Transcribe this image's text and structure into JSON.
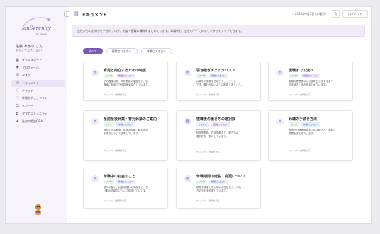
{
  "brand": {
    "logo_text": "anSerenity",
    "logo_sub": "for Parents"
  },
  "user": {
    "name": "佐藤 あかり さん",
    "greeting": "おかえりなさいませ！"
  },
  "sidebar": {
    "items": [
      {
        "label": "ダッシュボード",
        "icon": "dashboard-icon"
      },
      {
        "label": "プロフィール",
        "icon": "profile-icon"
      },
      {
        "label": "タスク",
        "icon": "task-icon"
      },
      {
        "label": "ドキュメント",
        "icon": "document-icon"
      },
      {
        "label": "チャット",
        "icon": "chat-icon"
      },
      {
        "label": "仲間のチェックイン",
        "icon": "checkin-icon"
      },
      {
        "label": "メンバー",
        "icon": "members-icon"
      },
      {
        "label": "ママのコミュニティ",
        "icon": "community-icon"
      },
      {
        "label": "社内の相談Q&A",
        "icon": "qa-icon"
      }
    ]
  },
  "header": {
    "title": "ドキュメント",
    "date": "2026年6月5日 (水曜日)",
    "logout": "ログアウト"
  },
  "notice": "会社からのお知らせや社内ブログ、制度・復職の資料をまとめています。休職中も、会社の\"今\"にゆるくキャッチアップできます。",
  "filters": [
    "すべて",
    "復職される方へ",
    "休職に入る方へ"
  ],
  "cards": [
    {
      "title": "育児と両立するための制度",
      "tags": [
        {
          "label": "リンク",
          "color": "green"
        },
        {
          "label": "復職される方へ",
          "color": "purple"
        }
      ],
      "desc": [
        "子の看護休暇、時短勤務の制度など、復",
        "職後に利用できる制度を紹介しています。"
      ],
      "link": "クリックして詳細を見る"
    },
    {
      "title": "引き継ぎチェックリスト",
      "tags": [
        {
          "label": "リンク",
          "color": "green"
        },
        {
          "label": "休職に入る方へ",
          "color": "blue"
        }
      ],
      "desc": [
        "休職前の業務引き継ぎチェックリスト",
        "です。漏れがないように確認しましょう。"
      ],
      "link": "クリックして詳細を見る"
    },
    {
      "title": "復職までの流れ",
      "tags": [
        {
          "label": "リンク",
          "color": "green"
        },
        {
          "label": "復職される方へ",
          "color": "purple"
        }
      ],
      "desc": [
        "復職の意思表示から復職日が決まるまで",
        "の手続き・流れをまとめています。"
      ],
      "link": "クリックして詳細を見る"
    },
    {
      "title": "産前産後休業・育児休業のご案内",
      "tags": [
        {
          "label": "リンク",
          "color": "green"
        },
        {
          "label": "休職に入る方へ",
          "color": "blue"
        }
      ],
      "desc": [
        "取得できる期間、申請の時期、給付金の",
        "手続きについて説明しています。"
      ],
      "link": "クリックして詳細を見る"
    },
    {
      "title": "復職後の働き方の選択肢",
      "file": "worksch.pdf",
      "tags": [
        {
          "label": "ファイル",
          "color": "blue"
        },
        {
          "label": "復職される方へ",
          "color": "purple"
        }
      ],
      "desc": [
        "短時間勤務、在宅勤務など、働き方の",
        "選択肢を一覧にしています。"
      ],
      "link": "クリックして詳細を見る"
    },
    {
      "title": "休職の手続き方法",
      "tags": [
        {
          "label": "リンク",
          "color": "green"
        },
        {
          "label": "休職に入る方へ",
          "color": "blue"
        }
      ],
      "desc": [
        "申請から休職開始までの手続きと、必要な",
        "書類をまとめています。"
      ],
      "link": "クリックして詳細を見る"
    },
    {
      "title": "休職中のお金のこと",
      "tags": [
        {
          "label": "リンク",
          "color": "green"
        },
        {
          "label": "休職に入る方へ",
          "color": "blue"
        }
      ],
      "desc": [
        "給与の扱い、社会保険料の免除など、受",
        "け取れる給付について説明しています。"
      ],
      "link": "クリックして詳細を見る"
    },
    {
      "title": "休職期間の延長・変更について",
      "tags": [
        {
          "label": "リンク",
          "color": "green"
        },
        {
          "label": "休職に入る方へ",
          "color": "blue"
        }
      ],
      "desc": [
        "期間を変更したい場合の相談先と、手続",
        "きの流れを記載しています。"
      ],
      "link": "クリックして詳細を見る"
    }
  ],
  "colors": {
    "accent": "#7a58b5",
    "sidebar_bg": "#f6f4fa"
  }
}
